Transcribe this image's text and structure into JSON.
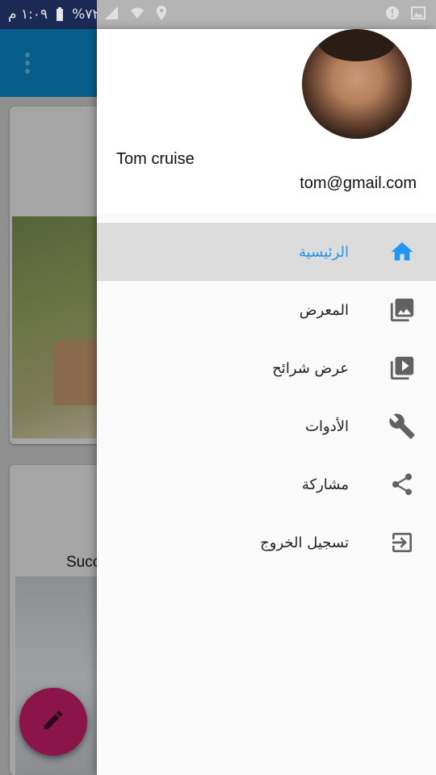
{
  "status_bar": {
    "time": "١:٠٩ م",
    "battery": "%٧٢"
  },
  "background": {
    "card_title": "Succ"
  },
  "drawer": {
    "user_name": "Tom cruise",
    "user_email": "tom@gmail.com",
    "menu": [
      {
        "label": "الرئيسية",
        "icon": "home-icon",
        "active": true
      },
      {
        "label": "المعرض",
        "icon": "gallery-icon",
        "active": false
      },
      {
        "label": "عرض شرائح",
        "icon": "slideshow-icon",
        "active": false
      },
      {
        "label": "الأدوات",
        "icon": "tools-icon",
        "active": false
      },
      {
        "label": "مشاركة",
        "icon": "share-icon",
        "active": false
      },
      {
        "label": "تسجيل الخروج",
        "icon": "logout-icon",
        "active": false
      }
    ]
  },
  "colors": {
    "accent": "#2196f3",
    "app_bar": "#0277bd",
    "fab": "#d81b60",
    "active_row": "#dcdcdc"
  }
}
